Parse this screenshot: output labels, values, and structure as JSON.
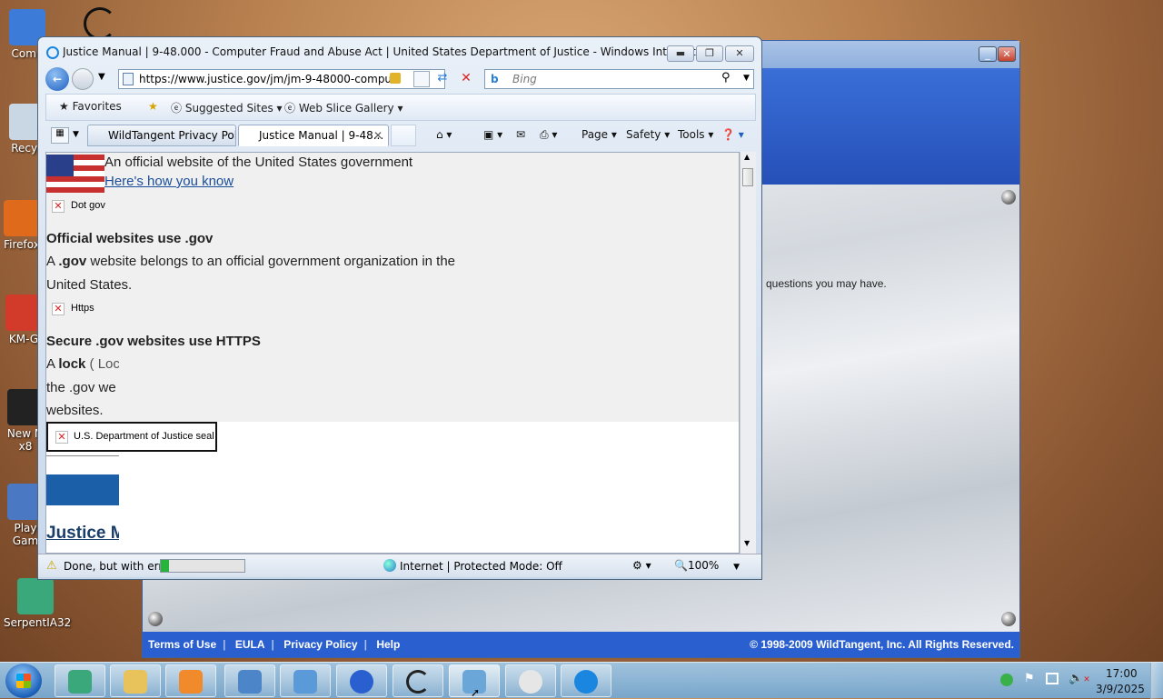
{
  "desktop": {
    "icons": [
      {
        "label": "Comp",
        "color": "#3d7bd8"
      },
      {
        "label": "Recyc",
        "color": "#c9d6e3"
      },
      {
        "label": "Firefox",
        "color": "#e06a1b"
      },
      {
        "label": "KM-G",
        "color": "#d23a2a"
      },
      {
        "label": "New M x8",
        "color": "#222"
      },
      {
        "label": "Play Gam",
        "color": "#4a78c2"
      },
      {
        "label": "SerpentIA32",
        "color": "#3aa87a"
      }
    ]
  },
  "wildtangent": {
    "body_text": "questions you may have.",
    "footer": {
      "links": [
        "Terms of Use",
        "EULA",
        "Privacy Policy",
        "Help"
      ],
      "copyright": "© 1998-2009 WildTangent, Inc. All Rights Reserved."
    }
  },
  "ie": {
    "title": "Justice Manual | 9-48.000 - Computer Fraud and Abuse Act | United States Department of Justice - Windows Internet Explorer",
    "address": "https://www.justice.gov/jm/jm-9-48000-compu",
    "search_placeholder": "Bing",
    "favorites_bar": {
      "favorites": "Favorites",
      "suggested": "Suggested Sites",
      "webslice": "Web Slice Gallery"
    },
    "tabs": [
      "WildTangent Privacy Pol...",
      "Justice Manual | 9-48..."
    ],
    "commands": {
      "page": "Page",
      "safety": "Safety",
      "tools": "Tools"
    },
    "content": {
      "banner": "An official website of the United States government",
      "how": "Here's how you know",
      "dotgov_alt": "Dot gov",
      "h1": "Official websites use .gov",
      "p1a": "A",
      "p1b": ".gov",
      "p1c": "website belongs to an official government organization in the",
      "p1d": "United States.",
      "https_alt": "Https",
      "h2": "Secure .gov websites use HTTPS",
      "p2a": "A",
      "p2b": "lock",
      "p2c": "( Loc",
      "p2d": "the .gov we",
      "p2e": "websites.",
      "seal_alt": "U.S. Department of Justice seal",
      "heading": "Justice M"
    },
    "status": {
      "text": "Done, but with erro",
      "zone": "Internet | Protected Mode: Off",
      "zoom": "100%",
      "progress": 0.1
    }
  },
  "taskbar": {
    "time": "17:00",
    "date": "3/9/2025",
    "buttons": [
      {
        "name": "serpent",
        "color": "#3aa87a"
      },
      {
        "name": "explorer",
        "color": "#e8c25a"
      },
      {
        "name": "media",
        "color": "#f08a2a"
      },
      {
        "name": "screenshot",
        "color": "#4d86c8"
      },
      {
        "name": "control",
        "color": "#5a9ad8"
      },
      {
        "name": "gf",
        "color": "#2a5fd0"
      },
      {
        "name": "serpent2",
        "color": "#222"
      },
      {
        "name": "package",
        "color": "#6aa6d8"
      },
      {
        "name": "penguin",
        "color": "#e6e6e6"
      },
      {
        "name": "ie",
        "color": "#1a86e0"
      }
    ]
  }
}
